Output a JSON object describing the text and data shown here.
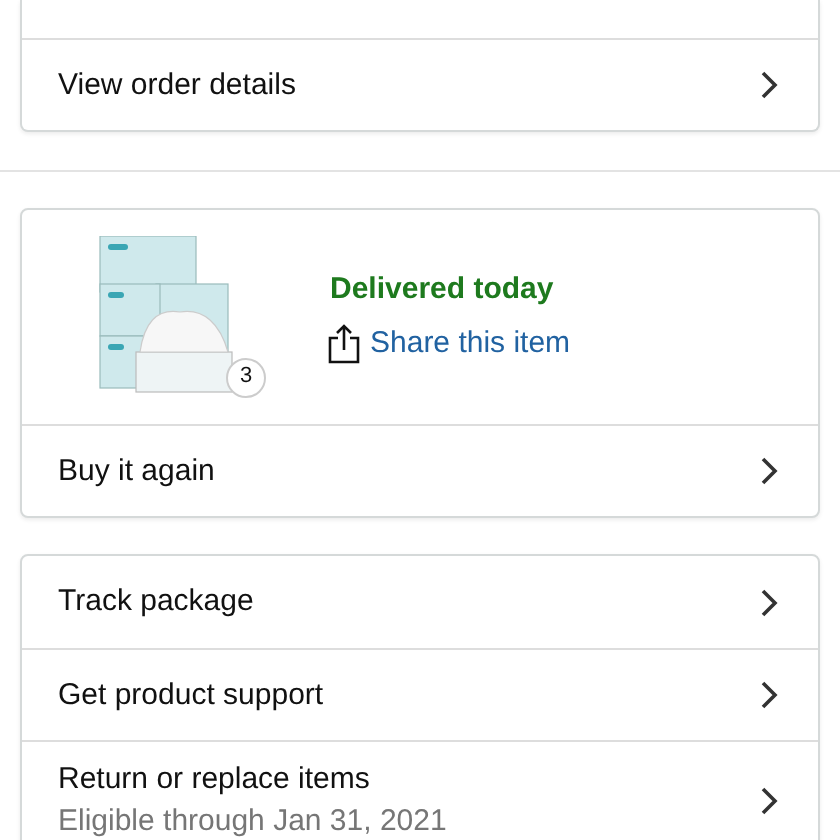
{
  "order_actions": [
    {
      "label": "View order details"
    }
  ],
  "item": {
    "kind": "picture",
    "quantity": "3",
    "status": "Delivered today",
    "share": "Share this item"
  },
  "item_actions": [
    {
      "label": "Buy it again"
    }
  ],
  "package_actions": [
    {
      "label": "Track package"
    },
    {
      "label": "Get product support"
    },
    {
      "label": "Return or replace items",
      "subtitle": "Eligible through Jan 31, 2021"
    }
  ]
}
